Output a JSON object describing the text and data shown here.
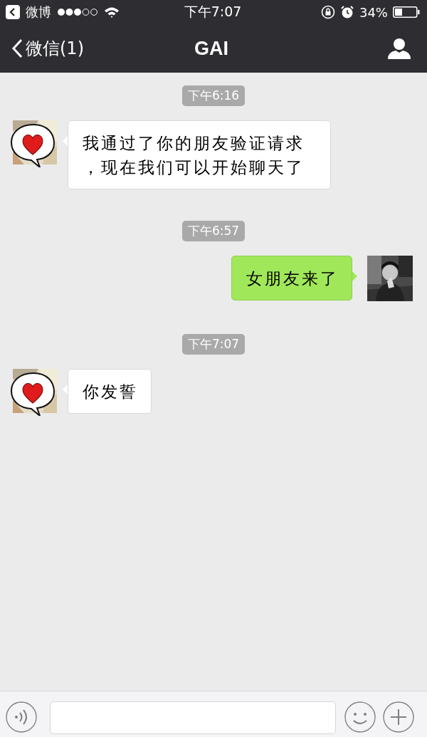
{
  "status_bar": {
    "back_app": "微博",
    "time": "下午7:07",
    "battery": "34%"
  },
  "nav_bar": {
    "back": "微信(1)",
    "title": "GAI"
  },
  "messages": [
    {
      "kind": "time",
      "text": "下午6:16"
    },
    {
      "kind": "message",
      "outgoing": false,
      "text": "我通过了你的朋友验证请求，现在我们可以开始聊天了"
    },
    {
      "kind": "time",
      "text": "下午6:57"
    },
    {
      "kind": "message",
      "outgoing": true,
      "text": "女朋友来了"
    },
    {
      "kind": "time",
      "text": "下午7:07"
    },
    {
      "kind": "message",
      "outgoing": false,
      "text": "你发誓"
    }
  ]
}
